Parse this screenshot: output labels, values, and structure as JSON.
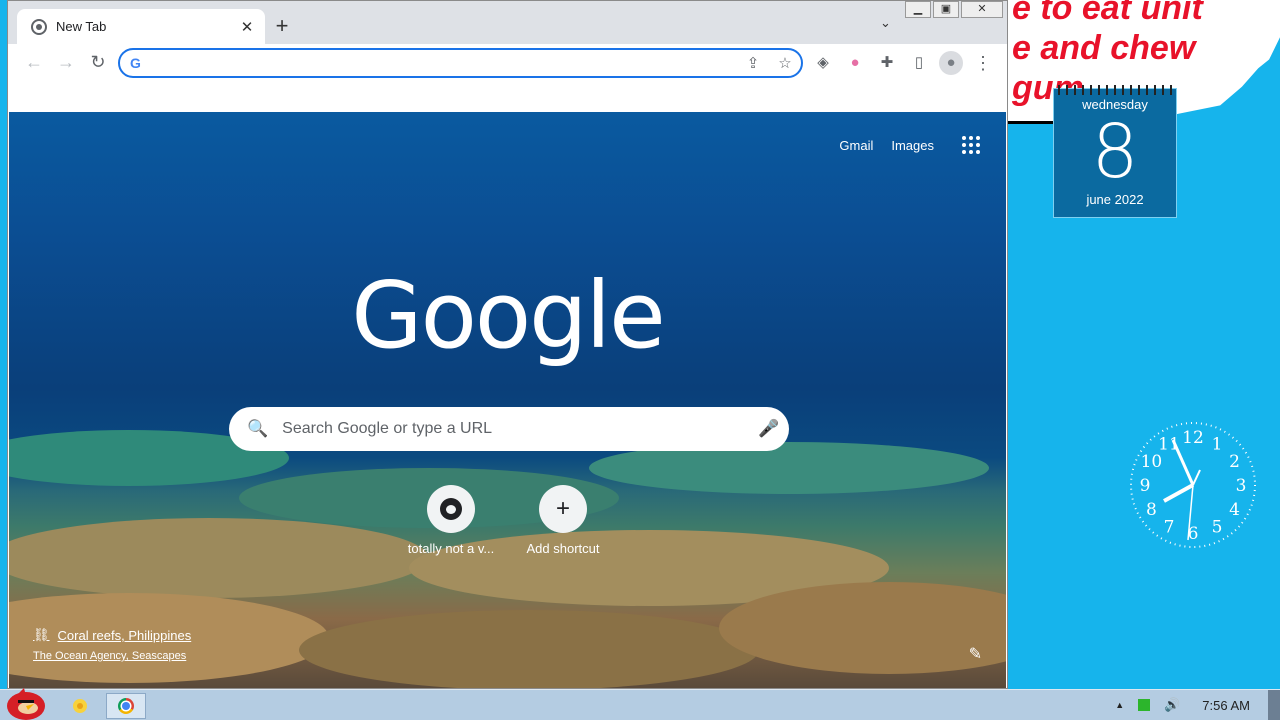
{
  "desktop": {
    "note": {
      "lines": [
        "e to eat unit",
        "e and chew",
        "gum"
      ]
    },
    "calendar": {
      "weekday": "wednesday",
      "day": "8",
      "month_year": "june 2022"
    },
    "clock": {
      "numerals": [
        "12",
        "1",
        "2",
        "3",
        "4",
        "5",
        "6",
        "7",
        "8",
        "9",
        "10",
        "11"
      ],
      "time": "7:56"
    }
  },
  "browser": {
    "tab": {
      "title": "New Tab",
      "close": "✕"
    },
    "new_tab": "+",
    "tab_search": "⌄",
    "window_controls": {
      "minimize": "▁",
      "maximize": "▣",
      "close": "✕"
    },
    "nav": {
      "back": "←",
      "forward": "→",
      "reload": "↻"
    },
    "omnibox": {
      "logo": "G",
      "value": "",
      "placeholder": ""
    },
    "omnibox_icons": {
      "share": "⇪",
      "bookmark": "☆"
    },
    "extensions": {
      "ublock": "◈",
      "flag": "●",
      "puzzle": "✚",
      "sidepanel": "▯",
      "profile": "●",
      "menu": "⋮"
    }
  },
  "ntp": {
    "links": {
      "gmail": "Gmail",
      "images": "Images"
    },
    "logo": "Google",
    "search": {
      "placeholder": "Search Google or type a URL",
      "icon": "🔍",
      "mic": "🎤"
    },
    "shortcuts": [
      {
        "label": "totally not a v...",
        "icon": "github-icon"
      },
      {
        "label": "Add shortcut",
        "icon": "plus-icon",
        "glyph": "+"
      }
    ],
    "attribution": {
      "title": "Coral reefs, Philippines",
      "subtitle": "The Ocean Agency, Seascapes",
      "link_icon": "⛓"
    },
    "customize_icon": "✎"
  },
  "taskbar": {
    "apps": [
      "explorer",
      "chrome"
    ],
    "tray": {
      "up_arrow": "▲",
      "volume": "🔊",
      "time": "7:56 AM"
    }
  }
}
